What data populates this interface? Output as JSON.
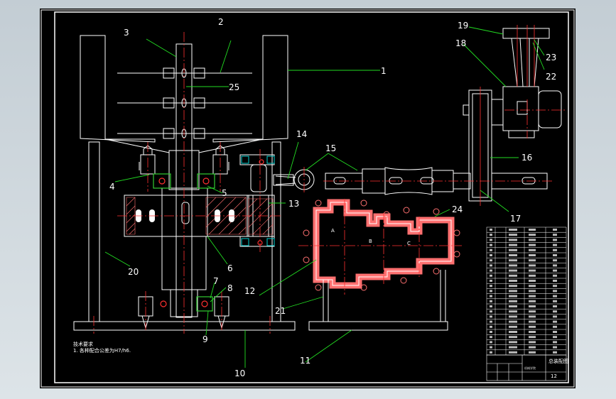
{
  "colors": {
    "outline": "#ffffff",
    "center_line": "#ff3030",
    "leader": "#22dd22",
    "hatch": "#ff7070",
    "highlight": "#33cc33",
    "cyan": "#00d0d0",
    "background": "#000000"
  },
  "part_labels": [
    "1",
    "2",
    "3",
    "4",
    "5",
    "6",
    "7",
    "8",
    "9",
    "10",
    "11",
    "12",
    "13",
    "14",
    "15",
    "16",
    "17",
    "18",
    "19",
    "20",
    "21",
    "22",
    "23",
    "24",
    "25"
  ],
  "cavity_labels": [
    "A",
    "B",
    "C"
  ],
  "notes": {
    "title": "技术要求",
    "line1": "1. 各种配合公差为H7/h6."
  },
  "title_block": {
    "drawing_name": "总装配图",
    "sheet_no": "12",
    "school": "机械学院"
  }
}
